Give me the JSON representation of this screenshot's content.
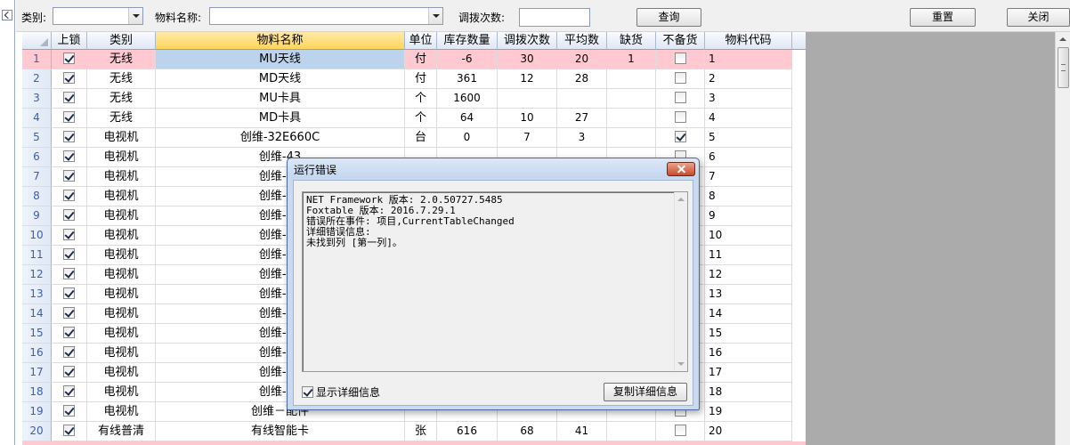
{
  "toolbar": {
    "category_label": "类别:",
    "category_value": "",
    "material_name_label": "物料名称:",
    "material_name_value": "",
    "transfer_count_label": "调拨次数:",
    "transfer_count_value": "",
    "query_button": "查询",
    "reset_button": "重置",
    "close_button": "关闭"
  },
  "grid": {
    "columns": [
      "上锁",
      "类别",
      "物料名称",
      "单位",
      "库存数量",
      "调拨次数",
      "平均数",
      "缺货",
      "不备货",
      "物料代码"
    ],
    "rows": [
      {
        "no": "1",
        "locked": true,
        "category": "无线",
        "name": "MU天线",
        "unit": "付",
        "stock": "-6",
        "transfers": "30",
        "avg": "20",
        "shortage": "1",
        "no_stock": false,
        "code": "1"
      },
      {
        "no": "2",
        "locked": true,
        "category": "无线",
        "name": "MD天线",
        "unit": "付",
        "stock": "361",
        "transfers": "12",
        "avg": "28",
        "shortage": "",
        "no_stock": false,
        "code": "2"
      },
      {
        "no": "3",
        "locked": true,
        "category": "无线",
        "name": "MU卡具",
        "unit": "个",
        "stock": "1600",
        "transfers": "",
        "avg": "",
        "shortage": "",
        "no_stock": false,
        "code": "3"
      },
      {
        "no": "4",
        "locked": true,
        "category": "无线",
        "name": "MD卡具",
        "unit": "个",
        "stock": "64",
        "transfers": "10",
        "avg": "27",
        "shortage": "",
        "no_stock": false,
        "code": "4"
      },
      {
        "no": "5",
        "locked": true,
        "category": "电视机",
        "name": "创维-32E660C",
        "unit": "台",
        "stock": "0",
        "transfers": "7",
        "avg": "3",
        "shortage": "",
        "no_stock": true,
        "code": "5"
      },
      {
        "no": "6",
        "locked": true,
        "category": "电视机",
        "name": "创维-43",
        "unit": "",
        "stock": "",
        "transfers": "",
        "avg": "",
        "shortage": "",
        "no_stock": false,
        "code": "6"
      },
      {
        "no": "7",
        "locked": true,
        "category": "电视机",
        "name": "创维-43",
        "unit": "",
        "stock": "",
        "transfers": "",
        "avg": "",
        "shortage": "",
        "no_stock": false,
        "code": "7"
      },
      {
        "no": "8",
        "locked": true,
        "category": "电视机",
        "name": "创维-43",
        "unit": "",
        "stock": "",
        "transfers": "",
        "avg": "",
        "shortage": "",
        "no_stock": false,
        "code": "8"
      },
      {
        "no": "9",
        "locked": true,
        "category": "电视机",
        "name": "创维-49",
        "unit": "",
        "stock": "",
        "transfers": "",
        "avg": "",
        "shortage": "",
        "no_stock": false,
        "code": "9"
      },
      {
        "no": "10",
        "locked": true,
        "category": "电视机",
        "name": "创维-49",
        "unit": "",
        "stock": "",
        "transfers": "",
        "avg": "",
        "shortage": "",
        "no_stock": false,
        "code": "10"
      },
      {
        "no": "11",
        "locked": true,
        "category": "电视机",
        "name": "创维-49",
        "unit": "",
        "stock": "",
        "transfers": "",
        "avg": "",
        "shortage": "",
        "no_stock": false,
        "code": "11"
      },
      {
        "no": "12",
        "locked": true,
        "category": "电视机",
        "name": "创维-50",
        "unit": "",
        "stock": "",
        "transfers": "",
        "avg": "",
        "shortage": "",
        "no_stock": false,
        "code": "12"
      },
      {
        "no": "13",
        "locked": true,
        "category": "电视机",
        "name": "创维-55",
        "unit": "",
        "stock": "",
        "transfers": "",
        "avg": "",
        "shortage": "",
        "no_stock": false,
        "code": "13"
      },
      {
        "no": "14",
        "locked": true,
        "category": "电视机",
        "name": "创维-55",
        "unit": "",
        "stock": "",
        "transfers": "",
        "avg": "",
        "shortage": "",
        "no_stock": false,
        "code": "14"
      },
      {
        "no": "15",
        "locked": true,
        "category": "电视机",
        "name": "创维-55",
        "unit": "",
        "stock": "",
        "transfers": "",
        "avg": "",
        "shortage": "",
        "no_stock": false,
        "code": "15"
      },
      {
        "no": "16",
        "locked": true,
        "category": "电视机",
        "name": "创维-55",
        "unit": "",
        "stock": "",
        "transfers": "",
        "avg": "",
        "shortage": "",
        "no_stock": false,
        "code": "16"
      },
      {
        "no": "17",
        "locked": true,
        "category": "电视机",
        "name": "创维-60",
        "unit": "",
        "stock": "",
        "transfers": "",
        "avg": "",
        "shortage": "",
        "no_stock": false,
        "code": "17"
      },
      {
        "no": "18",
        "locked": true,
        "category": "电视机",
        "name": "创维-65",
        "unit": "",
        "stock": "",
        "transfers": "",
        "avg": "",
        "shortage": "",
        "no_stock": false,
        "code": "18"
      },
      {
        "no": "19",
        "locked": true,
        "category": "电视机",
        "name": "创维－配件",
        "unit": "",
        "stock": "",
        "transfers": "",
        "avg": "",
        "shortage": "",
        "no_stock": false,
        "code": "19"
      },
      {
        "no": "20",
        "locked": true,
        "category": "有线普清",
        "name": "有线智能卡",
        "unit": "张",
        "stock": "616",
        "transfers": "68",
        "avg": "41",
        "shortage": "",
        "no_stock": false,
        "code": "20"
      }
    ]
  },
  "dialog": {
    "title": "运行错误",
    "message_lines": [
      "NET Framework 版本: 2.0.50727.5485",
      "Foxtable 版本: 2016.7.29.1",
      "错误所在事件: 项目,CurrentTableChanged",
      "详细错误信息:",
      "未找到列 [第一列]。"
    ],
    "show_detail_label": "显示详细信息",
    "show_detail_checked": true,
    "copy_button": "复制详细信息"
  },
  "colors": {
    "selected_row": "#ffc9d2",
    "current_cell": "#bcd3ee",
    "active_header": "#ffd55a",
    "background_area": "#ababab"
  }
}
